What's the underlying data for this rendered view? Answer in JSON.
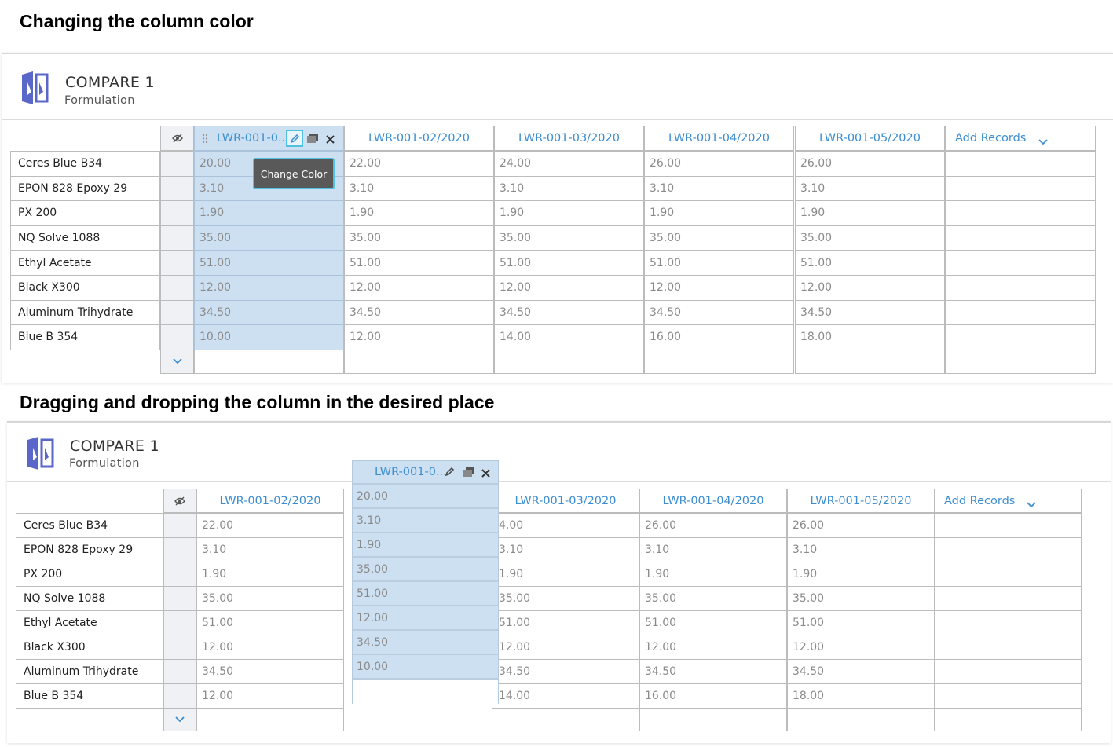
{
  "captions": {
    "top": "Changing the column color",
    "bottom": "Dragging and dropping the column in the desired place"
  },
  "app": {
    "title": "COMPARE 1",
    "subtitle": "Formulation"
  },
  "row_labels": [
    "Ceres Blue B34",
    "EPON 828 Epoxy 29",
    "PX 200",
    "NQ Solve 1088",
    "Ethyl Acetate",
    "Black X300",
    "Aluminum Trihydrate",
    "Blue B 354"
  ],
  "columns": [
    {
      "label": "LWR-001-0...",
      "values": [
        "20.00",
        "3.10",
        "1.90",
        "35.00",
        "51.00",
        "12.00",
        "34.50",
        "10.00"
      ]
    },
    {
      "label": "LWR-001-02/2020",
      "values": [
        "22.00",
        "3.10",
        "1.90",
        "35.00",
        "51.00",
        "12.00",
        "34.50",
        "12.00"
      ]
    },
    {
      "label": "LWR-001-03/2020",
      "values": [
        "24.00",
        "3.10",
        "1.90",
        "35.00",
        "51.00",
        "12.00",
        "34.50",
        "14.00"
      ]
    },
    {
      "label": "LWR-001-04/2020",
      "values": [
        "26.00",
        "3.10",
        "1.90",
        "35.00",
        "51.00",
        "12.00",
        "34.50",
        "16.00"
      ]
    },
    {
      "label": "LWR-001-05/2020",
      "values": [
        "26.00",
        "3.10",
        "1.90",
        "35.00",
        "51.00",
        "12.00",
        "34.50",
        "18.00"
      ]
    }
  ],
  "occluded_col3": {
    "values": [
      "4.00",
      "3.10",
      "1.90",
      "35.00",
      "51.00",
      "12.00",
      "34.50",
      "14.00"
    ]
  },
  "add_records": "Add Records",
  "tooltip": "Change Color",
  "accent_color": "#3b8ed1",
  "selected_column_color": "#cde0f1",
  "icons": [
    "hide-eye-icon",
    "drag-handle-icon",
    "pencil-icon",
    "copy-icon",
    "close-icon",
    "chevron-down-icon",
    "compare-app-icon"
  ]
}
